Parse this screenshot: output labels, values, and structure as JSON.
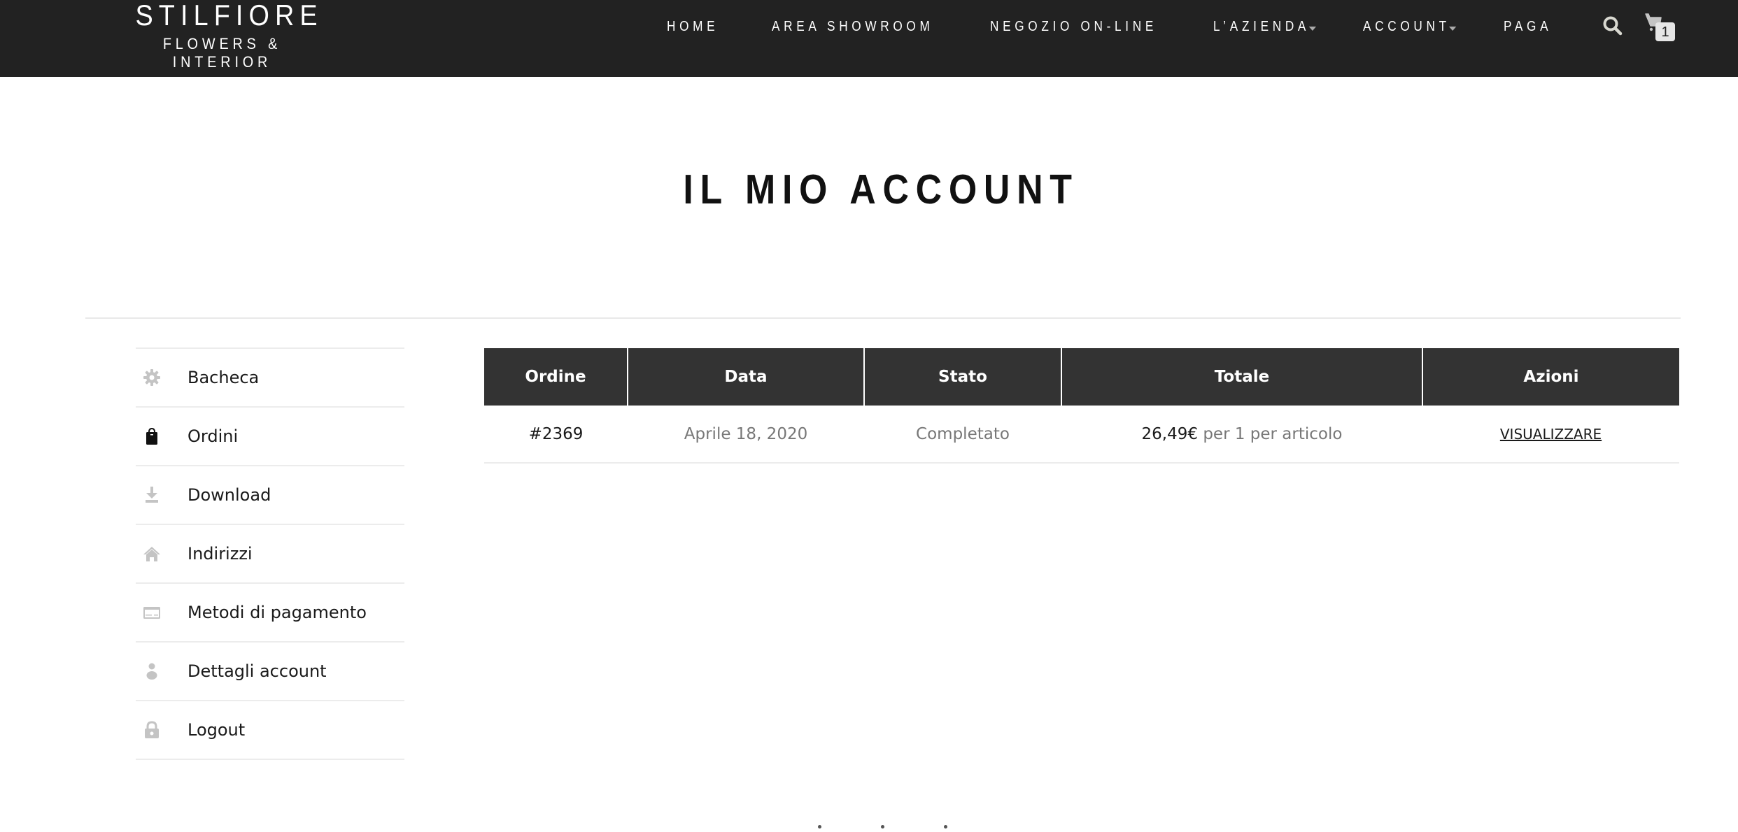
{
  "header": {
    "logo_title": "STILFIORE",
    "logo_subtitle": "FLOWERS & INTERIOR",
    "nav": [
      {
        "label": "HOME",
        "dropdown": false
      },
      {
        "label": "AREA SHOWROOM",
        "dropdown": false
      },
      {
        "label": "NEGOZIO ON-LINE",
        "dropdown": false
      },
      {
        "label": "L’AZIENDA",
        "dropdown": true
      },
      {
        "label": "ACCOUNT",
        "dropdown": true
      },
      {
        "label": "PAGA",
        "dropdown": false
      }
    ],
    "search_icon": "search-icon",
    "cart_icon": "cart-icon",
    "cart_count": "1"
  },
  "page": {
    "title": "IL MIO ACCOUNT"
  },
  "sidebar": {
    "items": [
      {
        "label": "Bacheca",
        "icon": "gear-icon",
        "active": false
      },
      {
        "label": "Ordini",
        "icon": "shopping-bag-icon",
        "active": true
      },
      {
        "label": "Download",
        "icon": "download-icon",
        "active": false
      },
      {
        "label": "Indirizzi",
        "icon": "home-icon",
        "active": false
      },
      {
        "label": "Metodi di pagamento",
        "icon": "credit-card-icon",
        "active": false
      },
      {
        "label": "Dettagli account",
        "icon": "user-icon",
        "active": false
      },
      {
        "label": "Logout",
        "icon": "lock-icon",
        "active": false
      }
    ]
  },
  "orders": {
    "columns": [
      "Ordine",
      "Data",
      "Stato",
      "Totale",
      "Azioni"
    ],
    "rows": [
      {
        "order": "#2369",
        "date": "Aprile 18, 2020",
        "status": "Completato",
        "total_amount": "26,49€",
        "total_suffix": " per 1 per articolo",
        "action": "VISUALIZZARE"
      }
    ]
  },
  "colors": {
    "header_bg": "#222222",
    "table_header_bg": "#333333",
    "divider": "#ececec",
    "icon_gray": "#c4c4c4"
  }
}
